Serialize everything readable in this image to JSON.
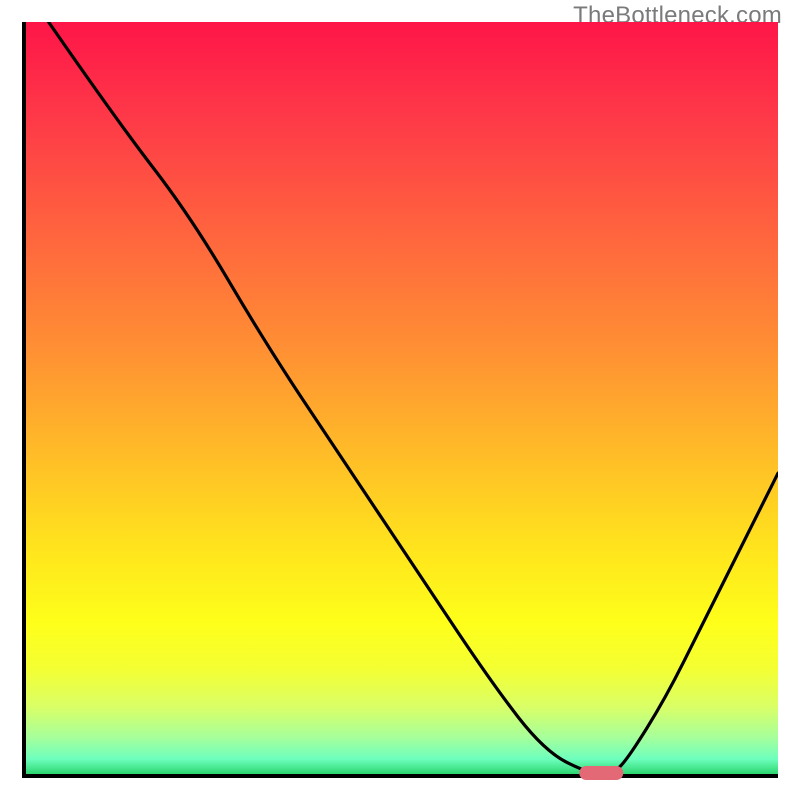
{
  "watermark": "TheBottleneck.com",
  "chart_data": {
    "type": "line",
    "title": "",
    "xlabel": "",
    "ylabel": "",
    "xlim": [
      0,
      100
    ],
    "ylim": [
      0,
      100
    ],
    "legend": false,
    "grid": false,
    "background": "vertical gradient red→yellow→green",
    "x": [
      3,
      12,
      22,
      32,
      42,
      52,
      62,
      69,
      75,
      78,
      80,
      85,
      90,
      95,
      100
    ],
    "values": [
      100,
      87,
      74,
      57,
      42,
      27,
      12,
      3,
      0,
      0,
      2,
      10,
      20,
      30,
      40
    ],
    "marker": {
      "x_center": 76.5,
      "y_value": 0,
      "color": "#e46976"
    },
    "gradient_stops": [
      {
        "pct": 0,
        "color": "#fe1548"
      },
      {
        "pct": 12,
        "color": "#fe3748"
      },
      {
        "pct": 28,
        "color": "#ff643e"
      },
      {
        "pct": 44,
        "color": "#ff9133"
      },
      {
        "pct": 58,
        "color": "#ffbe27"
      },
      {
        "pct": 70,
        "color": "#ffe41d"
      },
      {
        "pct": 80,
        "color": "#feff1a"
      },
      {
        "pct": 86,
        "color": "#f4ff33"
      },
      {
        "pct": 91,
        "color": "#daff66"
      },
      {
        "pct": 95,
        "color": "#a8ff99"
      },
      {
        "pct": 98,
        "color": "#6effbe"
      },
      {
        "pct": 100,
        "color": "#2dd670"
      }
    ]
  }
}
